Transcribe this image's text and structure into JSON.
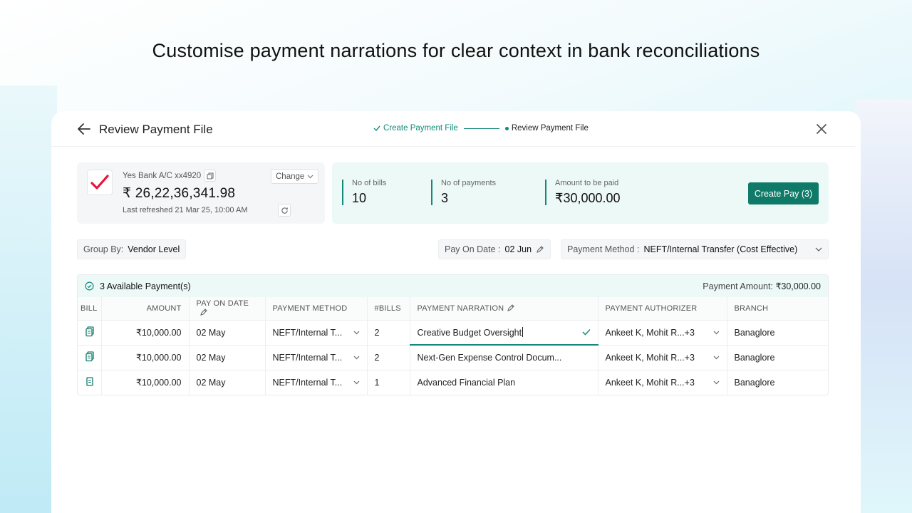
{
  "headline": "Customise payment narrations for clear context in bank reconciliations",
  "header": {
    "title": "Review Payment File",
    "steps": {
      "done": "Create Payment File",
      "current": "Review Payment File"
    }
  },
  "bank": {
    "account": "Yes Bank A/C xx4920",
    "change_label": "Change",
    "balance": "₹ 26,22,36,341.98",
    "refreshed": "Last refreshed 21 Mar 25, 10:00 AM"
  },
  "summary": {
    "bills_label": "No of bills",
    "bills_value": "10",
    "payments_label": "No of payments",
    "payments_value": "3",
    "amount_label": "Amount to be paid",
    "amount_value": "₹30,000.00",
    "create_label": "Create Pay (3)"
  },
  "filters": {
    "group_label": "Group By:",
    "group_value": "Vendor Level",
    "payon_label": "Pay On Date :",
    "payon_value": "02 Jun",
    "method_label": "Payment Method :",
    "method_value": "NEFT/Internal Transfer (Cost Effective)"
  },
  "table": {
    "available": "3 Available Payment(s)",
    "amount_label": "Payment Amount:",
    "amount_value": "₹30,000.00",
    "columns": [
      "BILL",
      "AMOUNT",
      "PAY ON DATE",
      "PAYMENT METHOD",
      "#BILLS",
      "PAYMENT NARRATION",
      "PAYMENT AUTHORIZER",
      "BRANCH"
    ],
    "rows": [
      {
        "amount": "₹10,000.00",
        "date": "02 May",
        "method": "NEFT/Internal T...",
        "bills": "2",
        "narration": "Creative Budget Oversight",
        "authorizer": "Ankeet K, Mohit R...+3",
        "branch": "Banaglore"
      },
      {
        "amount": "₹10,000.00",
        "date": "02 May",
        "method": "NEFT/Internal T...",
        "bills": "2",
        "narration": "Next-Gen Expense Control Docum...",
        "authorizer": "Ankeet K, Mohit R...+3",
        "branch": "Banaglore"
      },
      {
        "amount": "₹10,000.00",
        "date": "02 May",
        "method": "NEFT/Internal T...",
        "bills": "1",
        "narration": "Advanced Financial Plan",
        "authorizer": "Ankeet K, Mohit R...+3",
        "branch": "Banaglore"
      }
    ]
  },
  "colors": {
    "accent": "#138a7a",
    "button": "#0f7a68",
    "summary_bg": "#ecf9f7",
    "bank_logo": "#e2173b"
  },
  "icons": [
    "back-arrow-icon",
    "close-icon",
    "check-icon",
    "copy-icon",
    "chevron-down-icon",
    "refresh-icon",
    "pencil-icon",
    "check-circle-icon",
    "bill-icon",
    "bank-logo-icon"
  ]
}
